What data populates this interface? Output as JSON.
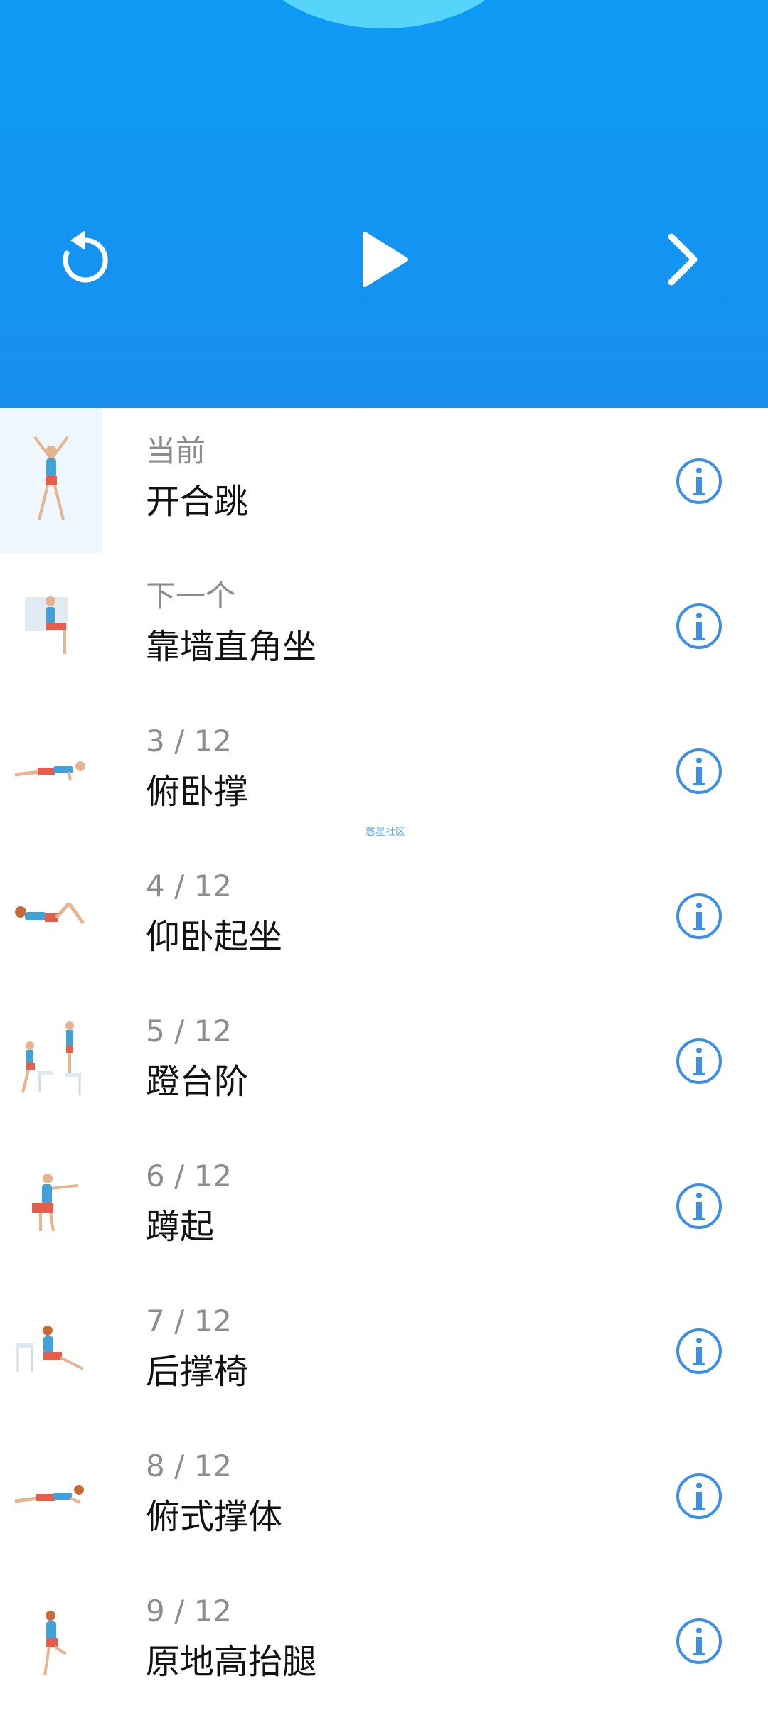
{
  "header": {
    "controls": [
      "restart-icon",
      "play-icon",
      "next-icon"
    ],
    "accent": "#1296f3",
    "arc_color": "#56d4f9"
  },
  "watermark": "慈星社区",
  "exercises": [
    {
      "sub": "当前",
      "title": "开合跳"
    },
    {
      "sub": "下一个",
      "title": "靠墙直角坐"
    },
    {
      "sub": "3 / 12",
      "title": "俯卧撑"
    },
    {
      "sub": "4 / 12",
      "title": "仰卧起坐"
    },
    {
      "sub": "5 / 12",
      "title": "蹬台阶"
    },
    {
      "sub": "6 / 12",
      "title": "蹲起"
    },
    {
      "sub": "7 / 12",
      "title": "后撑椅"
    },
    {
      "sub": "8 / 12",
      "title": "俯式撑体"
    },
    {
      "sub": "9 / 12",
      "title": "原地高抬腿"
    }
  ],
  "info_icon_color": "#3b8fe8"
}
